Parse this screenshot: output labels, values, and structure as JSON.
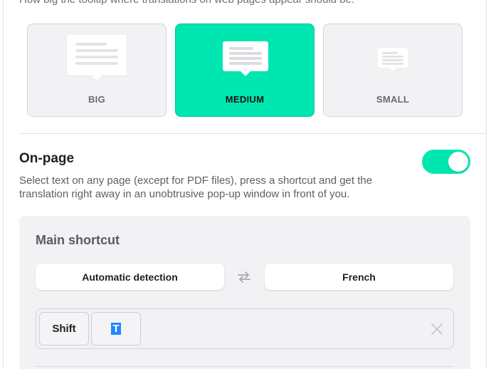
{
  "tooltip_size": {
    "description": "How big the tooltip where translations on web pages appear should be.",
    "options": [
      {
        "label": "BIG",
        "selected": false
      },
      {
        "label": "MEDIUM",
        "selected": true
      },
      {
        "label": "SMALL",
        "selected": false
      }
    ]
  },
  "on_page": {
    "title": "On-page",
    "description": "Select text on any page (except for PDF files), press a shortcut and get the translation right away in an unobtrusive pop-up window in front of you.",
    "enabled": true
  },
  "main_shortcut": {
    "title": "Main shortcut",
    "source_language": "Automatic detection",
    "target_language": "French",
    "keys": [
      "Shift",
      "T"
    ]
  },
  "colors": {
    "accent": "#00e6b0",
    "selection": "#1e88ff"
  },
  "icons": {
    "swap": "swap-languages-icon",
    "clear": "close-icon",
    "toggle": "toggle-switch"
  }
}
